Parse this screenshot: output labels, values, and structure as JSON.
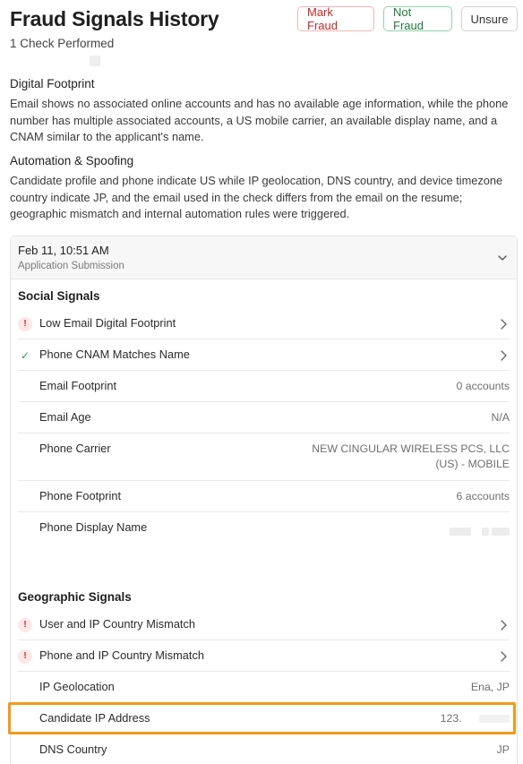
{
  "header": {
    "title": "Fraud Signals History",
    "subtitle": "1 Check Performed",
    "buttons": {
      "mark_fraud": "Mark Fraud",
      "not_fraud": "Not Fraud",
      "unsure": "Unsure"
    }
  },
  "summary": {
    "digital_footprint": {
      "heading": "Digital Footprint",
      "text": "Email shows no associated online accounts and has no available age information, while the phone number has multiple associated accounts, a US mobile carrier, an available display name, and a CNAM similar to the applicant's name."
    },
    "automation_spoofing": {
      "heading": "Automation & Spoofing",
      "text": "Candidate profile and phone indicate US while IP geolocation, DNS country, and device timezone country indicate JP, and the email used in the check differs from the email on the resume; geographic mismatch and internal automation rules were triggered."
    }
  },
  "check": {
    "date": "Feb 11, 10:51 AM",
    "source": "Application Submission",
    "social": {
      "title": "Social Signals",
      "flags": [
        {
          "label": "Low Email Digital Footprint",
          "status": "warning"
        },
        {
          "label": "Phone CNAM Matches Name",
          "status": "pass"
        }
      ],
      "details": [
        {
          "label": "Email Footprint",
          "value": "0 accounts"
        },
        {
          "label": "Email Age",
          "value": "N/A"
        },
        {
          "label": "Phone Carrier",
          "value_line1": "NEW CINGULAR WIRELESS PCS, LLC",
          "value_line2": "(US) - MOBILE"
        },
        {
          "label": "Phone Footprint",
          "value": "6 accounts"
        },
        {
          "label": "Phone Display Name",
          "value": ""
        }
      ]
    },
    "geo": {
      "title": "Geographic Signals",
      "flags": [
        {
          "label": "User and IP Country Mismatch",
          "status": "warning"
        },
        {
          "label": "Phone and IP Country Mismatch",
          "status": "warning"
        }
      ],
      "details": [
        {
          "label": "IP Geolocation",
          "value": "Ena, JP"
        },
        {
          "label": "Candidate IP Address",
          "value": "123."
        },
        {
          "label": "DNS Country",
          "value": "JP"
        }
      ]
    }
  },
  "icons": {
    "warning": "exclamation-icon",
    "pass": "check-icon",
    "chevron_right": "chevron-right-icon",
    "chevron_down": "chevron-down-icon"
  },
  "colors": {
    "warning": "#c62828",
    "pass": "#2e9a57",
    "highlight": "#f09a1a"
  }
}
